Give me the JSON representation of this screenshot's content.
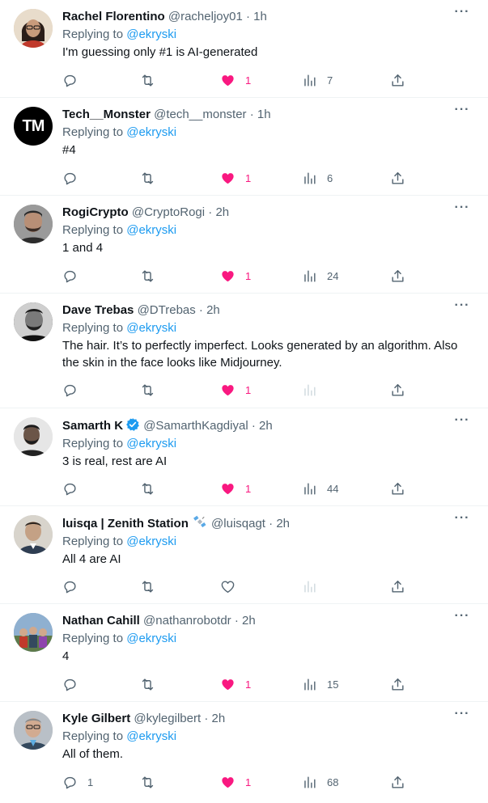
{
  "replying_prefix": "Replying to",
  "replies": [
    {
      "name": "Rachel Florentino",
      "handle": "@racheljoy01",
      "dot": "·",
      "time": "1h",
      "replying_to": "@ekryski",
      "text": "I'm guessing only #1 is AI-generated",
      "reply_count": "",
      "retweet_count": "",
      "like_count": "1",
      "liked": true,
      "view_count": "7",
      "more": "···"
    },
    {
      "name": "Tech__Monster",
      "handle": "@tech__monster",
      "dot": "·",
      "time": "1h",
      "replying_to": "@ekryski",
      "text": "#4",
      "avatar_text": "TM",
      "reply_count": "",
      "retweet_count": "",
      "like_count": "1",
      "liked": true,
      "view_count": "6",
      "more": "···"
    },
    {
      "name": "RogiCrypto",
      "handle": "@CryptoRogi",
      "dot": "·",
      "time": "2h",
      "replying_to": "@ekryski",
      "text": "1 and 4",
      "reply_count": "",
      "retweet_count": "",
      "like_count": "1",
      "liked": true,
      "view_count": "24",
      "more": "···"
    },
    {
      "name": "Dave Trebas",
      "handle": "@DTrebas",
      "dot": "·",
      "time": "2h",
      "replying_to": "@ekryski",
      "text": "The hair. It’s to perfectly imperfect. Looks generated by an algorithm. Also the skin in the face looks like Midjourney.",
      "reply_count": "",
      "retweet_count": "",
      "like_count": "1",
      "liked": true,
      "view_count": "",
      "more": "···"
    },
    {
      "name": "Samarth K",
      "handle": "@SamarthKagdiyal",
      "dot": "·",
      "time": "2h",
      "replying_to": "@ekryski",
      "text": "3 is real, rest are AI",
      "verified": true,
      "reply_count": "",
      "retweet_count": "",
      "like_count": "1",
      "liked": true,
      "view_count": "44",
      "more": "···"
    },
    {
      "name": "luisqa | Zenith Station",
      "handle": "@luisqagt",
      "dot": "·",
      "time": "2h",
      "replying_to": "@ekryski",
      "text": "All 4 are AI",
      "name_emoji": "satellite-emoji",
      "reply_count": "",
      "retweet_count": "",
      "like_count": "",
      "liked": false,
      "view_count": "",
      "more": "···"
    },
    {
      "name": "Nathan Cahill",
      "handle": "@nathanrobotdr",
      "dot": "·",
      "time": "2h",
      "replying_to": "@ekryski",
      "text": "4",
      "reply_count": "",
      "retweet_count": "",
      "like_count": "1",
      "liked": true,
      "view_count": "15",
      "more": "···"
    },
    {
      "name": "Kyle Gilbert",
      "handle": "@kylegilbert",
      "dot": "·",
      "time": "2h",
      "replying_to": "@ekryski",
      "text": "All of them.",
      "reply_count": "1",
      "retweet_count": "",
      "like_count": "1",
      "liked": true,
      "view_count": "68",
      "more": "···"
    }
  ],
  "colors": {
    "text": "#0f1419",
    "secondary": "#536471",
    "mention": "#1d9bf0",
    "like": "#f91880",
    "border": "#eff3f4",
    "verified": "#1d9bf0"
  }
}
